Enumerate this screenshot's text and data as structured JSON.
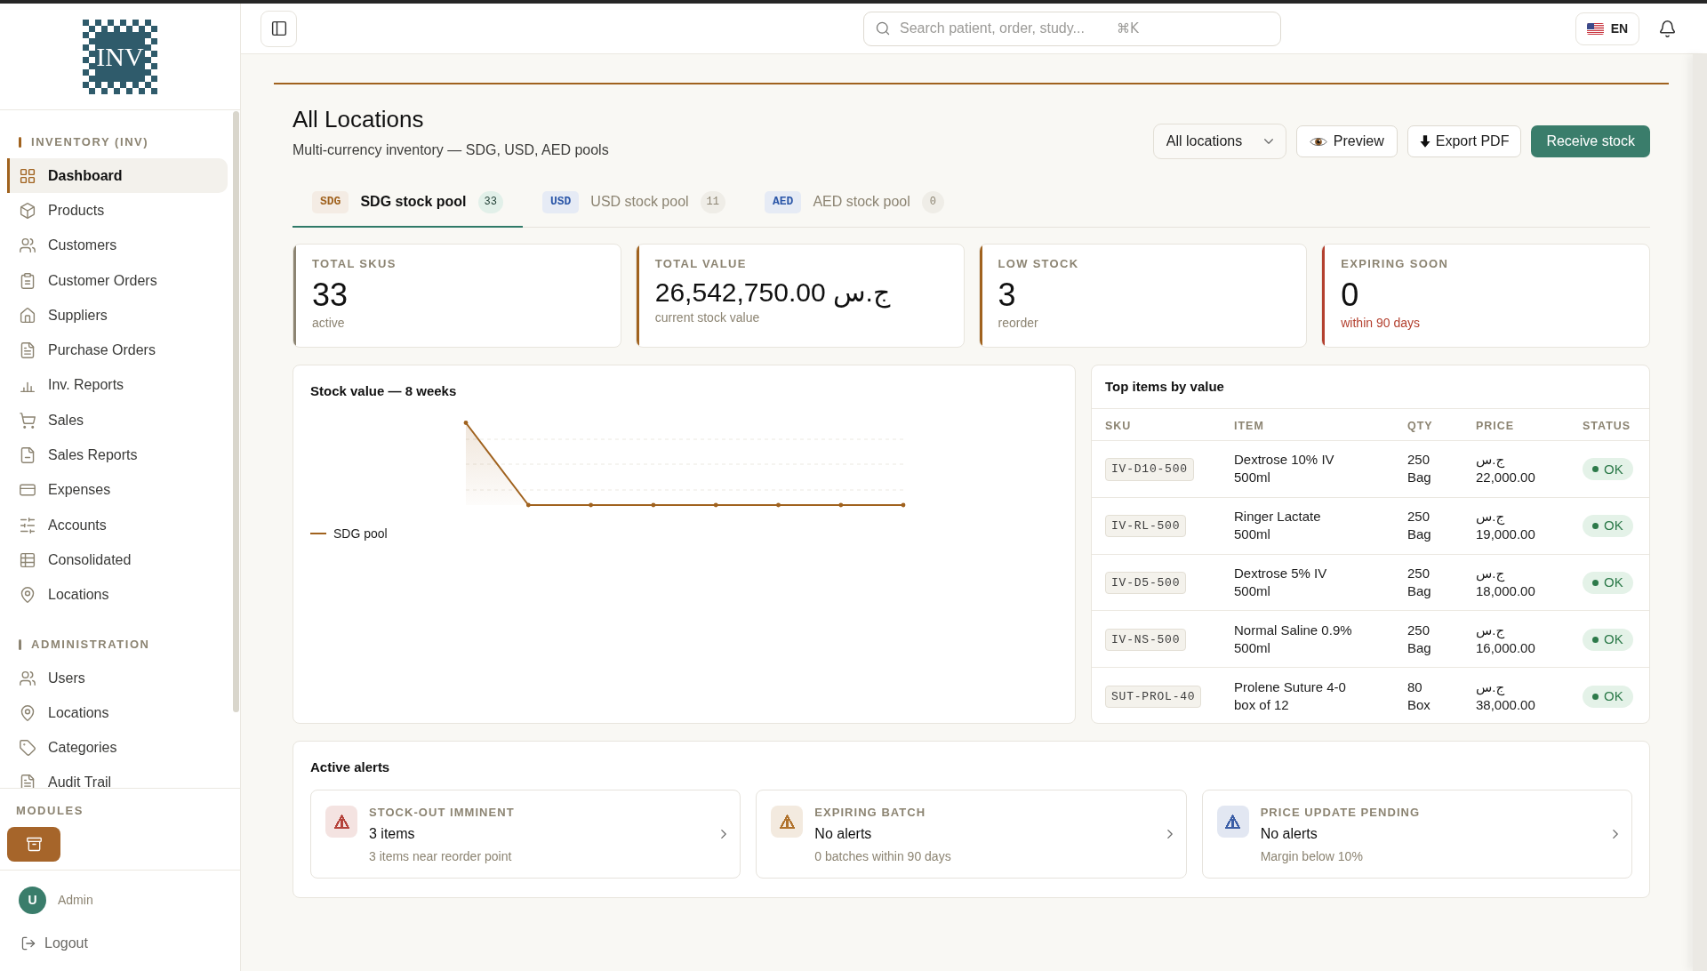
{
  "sidebar": {
    "logo": "INV",
    "sections": [
      {
        "title": "INVENTORY (INV)",
        "active": true,
        "items": [
          {
            "label": "Dashboard",
            "selected": true
          },
          {
            "label": "Products",
            "selected": false
          },
          {
            "label": "Customers",
            "selected": false
          },
          {
            "label": "Customer Orders",
            "selected": false
          },
          {
            "label": "Suppliers",
            "selected": false
          },
          {
            "label": "Purchase Orders",
            "selected": false
          },
          {
            "label": "Inv. Reports",
            "selected": false
          },
          {
            "label": "Sales",
            "selected": false
          },
          {
            "label": "Sales Reports",
            "selected": false
          },
          {
            "label": "Expenses",
            "selected": false
          },
          {
            "label": "Accounts",
            "selected": false
          },
          {
            "label": "Consolidated",
            "selected": false
          },
          {
            "label": "Locations",
            "selected": false
          }
        ]
      },
      {
        "title": "ADMINISTRATION",
        "active": false,
        "items": [
          {
            "label": "Users",
            "selected": false
          },
          {
            "label": "Locations",
            "selected": false
          },
          {
            "label": "Categories",
            "selected": false
          },
          {
            "label": "Audit Trail",
            "selected": false
          }
        ]
      }
    ],
    "modules": {
      "title": "MODULES",
      "buttons": [
        {
          "selected": true
        }
      ]
    },
    "user": {
      "initial": "U",
      "role": "Admin"
    },
    "logout": "Logout"
  },
  "header": {
    "search": {
      "placeholder": "Search patient, order, study...",
      "shortcut": "⌘K"
    },
    "language": "EN"
  },
  "page": {
    "title": "All Locations",
    "subtitle": "Multi-currency inventory — SDG, USD, AED pools",
    "location_select": "All locations",
    "actions": [
      {
        "label": "Preview",
        "kind": "preview"
      },
      {
        "label": "Export PDF",
        "kind": "export"
      },
      {
        "label": "Receive stock",
        "kind": "primary"
      }
    ]
  },
  "tabs": [
    {
      "code": "SDG",
      "label": "SDG stock pool",
      "count": "33",
      "selected": true,
      "color": "#a0621e"
    },
    {
      "code": "USD",
      "label": "USD stock pool",
      "count": "11",
      "selected": false,
      "color": "#2c57a8"
    },
    {
      "code": "AED",
      "label": "AED stock pool",
      "count": "0",
      "selected": false,
      "color": "#2c57a8"
    }
  ],
  "stats": [
    {
      "label": "TOTAL SKUS",
      "value": "33",
      "note": "active",
      "color": "#8c8472",
      "alert": false
    },
    {
      "label": "TOTAL VALUE",
      "value": "ج.س 26,542,750.00",
      "note": "current stock value",
      "color": "#a0621e",
      "alert": false
    },
    {
      "label": "LOW STOCK",
      "value": "3",
      "note": "reorder",
      "color": "#a0621e",
      "alert": false
    },
    {
      "label": "EXPIRING SOON",
      "value": "0",
      "note": "within 90 days",
      "color": "#b3402f",
      "alert": true
    }
  ],
  "stock_chart": {
    "title": "Stock value — 8 weeks",
    "legend": "SDG pool"
  },
  "top_items": {
    "title": "Top items by value",
    "columns": [
      "SKU",
      "ITEM",
      "QTY",
      "PRICE",
      "STATUS"
    ],
    "rows": [
      {
        "sku": "IV-D10-500",
        "item": "Dextrose 10% IV 500ml",
        "qty": "250 Bag",
        "price": "ج.س 22,000.00",
        "status": "OK"
      },
      {
        "sku": "IV-RL-500",
        "item": "Ringer Lactate 500ml",
        "qty": "250 Bag",
        "price": "ج.س 19,000.00",
        "status": "OK"
      },
      {
        "sku": "IV-D5-500",
        "item": "Dextrose 5% IV 500ml",
        "qty": "250 Bag",
        "price": "ج.س 18,000.00",
        "status": "OK"
      },
      {
        "sku": "IV-NS-500",
        "item": "Normal Saline 0.9% 500ml",
        "qty": "250 Bag",
        "price": "ج.س 16,000.00",
        "status": "OK"
      },
      {
        "sku": "SUT-PROL-40",
        "item": "Prolene Suture 4-0 box of 12",
        "qty": "80 Box",
        "price": "ج.س 38,000.00",
        "status": "OK"
      }
    ]
  },
  "alerts": {
    "title": "Active alerts",
    "items": [
      {
        "label": "STOCK-OUT IMMINENT",
        "value": "3 items",
        "detail": "3 items near reorder point",
        "color": "#b5423a"
      },
      {
        "label": "EXPIRING BATCH",
        "value": "No alerts",
        "detail": "0 batches within 90 days",
        "color": "#b0722c"
      },
      {
        "label": "PRICE UPDATE PENDING",
        "value": "No alerts",
        "detail": "Margin below 10%",
        "color": "#3b5ea6"
      }
    ]
  }
}
